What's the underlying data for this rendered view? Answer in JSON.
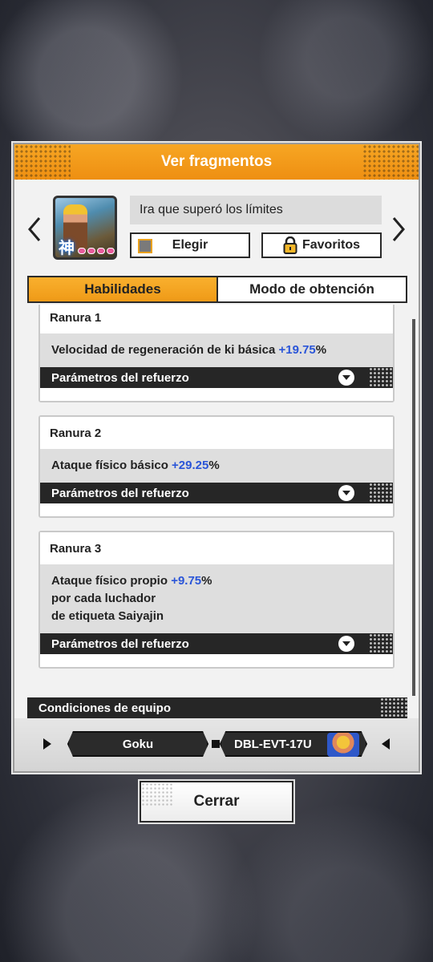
{
  "modal": {
    "title": "Ver fragmentos",
    "item_name": "Ira que superó los límites",
    "thumb_badge": "神",
    "choose_label": "Elegir",
    "favorites_label": "Favoritos"
  },
  "tabs": [
    {
      "label": "Habilidades",
      "active": true
    },
    {
      "label": "Modo de obtención",
      "active": false
    }
  ],
  "slots": [
    {
      "title": "Ranura 1",
      "desc_prefix": "Velocidad de regeneración de ki básica ",
      "value": "+19.75",
      "desc_suffix": "%",
      "param_label": "Parámetros del refuerzo"
    },
    {
      "title": "Ranura 2",
      "desc_prefix": "Ataque físico básico ",
      "value": "+29.25",
      "desc_suffix": "%",
      "param_label": "Parámetros del refuerzo"
    },
    {
      "title": "Ranura 3",
      "desc_prefix": "Ataque físico propio ",
      "value": "+9.75",
      "desc_suffix": "%",
      "desc_line2": "por cada luchador",
      "desc_line3": "de etiqueta Saiyajin",
      "param_label": "Parámetros del refuerzo"
    }
  ],
  "conditions": {
    "title": "Condiciones de equipo",
    "character": "Goku",
    "code": "DBL-EVT-17U"
  },
  "close_label": "Cerrar",
  "colors": {
    "accent": "#ef9a17",
    "value_blue": "#2a55d8",
    "dark_bar": "#262626"
  }
}
